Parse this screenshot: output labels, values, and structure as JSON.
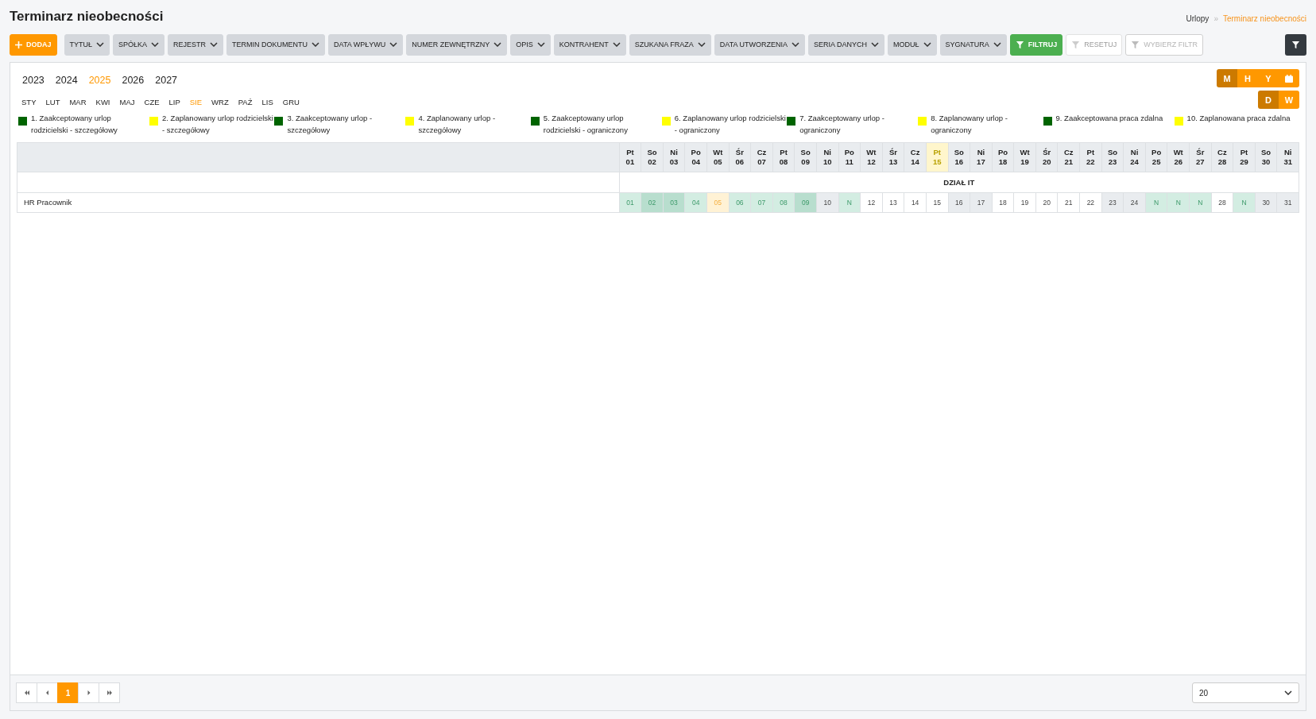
{
  "page": {
    "title": "Terminarz nieobecności"
  },
  "breadcrumb": {
    "items": [
      {
        "label": "Urlopy",
        "current": false
      },
      {
        "label": "Terminarz nieobecności",
        "current": true
      }
    ],
    "separator": "»"
  },
  "toolbar": [
    {
      "label": "DODAJ",
      "kind": "add",
      "disabled": false
    },
    {
      "label": "TYTUŁ",
      "kind": "dropdown",
      "disabled": false
    },
    {
      "label": "SPÓŁKA",
      "kind": "dropdown",
      "disabled": false
    },
    {
      "label": "REJESTR",
      "kind": "dropdown",
      "disabled": false
    },
    {
      "label": "TERMIN DOKUMENTU",
      "kind": "dropdown",
      "disabled": false
    },
    {
      "label": "DATA WPŁYWU",
      "kind": "dropdown",
      "disabled": false
    },
    {
      "label": "NUMER ZEWNĘTRZNY",
      "kind": "dropdown",
      "disabled": false
    },
    {
      "label": "OPIS",
      "kind": "dropdown",
      "disabled": false
    },
    {
      "label": "KONTRAHENT",
      "kind": "dropdown",
      "disabled": false
    },
    {
      "label": "SZUKANA FRAZA",
      "kind": "dropdown",
      "disabled": false
    },
    {
      "label": "DATA UTWORZENIA",
      "kind": "dropdown",
      "disabled": false
    },
    {
      "label": "SERIA DANYCH",
      "kind": "dropdown",
      "disabled": false
    },
    {
      "label": "MODUŁ",
      "kind": "dropdown",
      "disabled": false
    },
    {
      "label": "SYGNATURA",
      "kind": "dropdown",
      "disabled": false
    },
    {
      "label": "FILTRUJ",
      "kind": "filter",
      "disabled": false
    },
    {
      "label": "RESETUJ",
      "kind": "reset",
      "disabled": true
    },
    {
      "label": "WYBIERZ FILTR",
      "kind": "choose",
      "disabled": true
    }
  ],
  "years": [
    {
      "label": "2023",
      "selected": false
    },
    {
      "label": "2024",
      "selected": false
    },
    {
      "label": "2025",
      "selected": true
    },
    {
      "label": "2026",
      "selected": false
    },
    {
      "label": "2027",
      "selected": false
    }
  ],
  "months": [
    {
      "label": "STY",
      "selected": false
    },
    {
      "label": "LUT",
      "selected": false
    },
    {
      "label": "MAR",
      "selected": false
    },
    {
      "label": "KWI",
      "selected": false
    },
    {
      "label": "MAJ",
      "selected": false
    },
    {
      "label": "CZE",
      "selected": false
    },
    {
      "label": "LIP",
      "selected": false
    },
    {
      "label": "SIE",
      "selected": true
    },
    {
      "label": "WRZ",
      "selected": false
    },
    {
      "label": "PAŹ",
      "selected": false
    },
    {
      "label": "LIS",
      "selected": false
    },
    {
      "label": "GRU",
      "selected": false
    }
  ],
  "view_modes": [
    {
      "kind": "text",
      "label": "M",
      "selected": true
    },
    {
      "kind": "text",
      "label": "H",
      "selected": false
    },
    {
      "kind": "text",
      "label": "Y",
      "selected": false
    },
    {
      "kind": "calendar",
      "selected": false
    }
  ],
  "range_modes": [
    {
      "label": "D",
      "selected": true
    },
    {
      "label": "W",
      "selected": false
    }
  ],
  "legend": [
    {
      "label": "1. Zaakceptowany urlop rodzicielski - szczegółowy",
      "color": "#006400"
    },
    {
      "label": "2. Zaplanowany urlop rodzicielski - szczegółowy",
      "color": "#ffff00"
    },
    {
      "label": "3. Zaakceptowany urlop - szczegółowy",
      "color": "#006400"
    },
    {
      "label": "4. Zaplanowany urlop - szczegółowy",
      "color": "#ffff00"
    },
    {
      "label": "5. Zaakceptowany urlop rodzicielski - ograniczony",
      "color": "#006400"
    },
    {
      "label": "6. Zaplanowany urlop rodzicielski - ograniczony",
      "color": "#ffff00"
    },
    {
      "label": "7. Zaakceptowany urlop - ograniczony",
      "color": "#006400"
    },
    {
      "label": "8. Zaplanowany urlop - ograniczony",
      "color": "#ffff00"
    },
    {
      "label": "9. Zaakceptowana praca zdalna",
      "color": "#006400"
    },
    {
      "label": "10. Zaplanowana praca zdalna",
      "color": "#ffff00"
    }
  ],
  "table": {
    "days": [
      {
        "weekday": "Pt",
        "day": "01",
        "today": false
      },
      {
        "weekday": "So",
        "day": "02",
        "today": false
      },
      {
        "weekday": "Ni",
        "day": "03",
        "today": false
      },
      {
        "weekday": "Po",
        "day": "04",
        "today": false
      },
      {
        "weekday": "Wt",
        "day": "05",
        "today": false
      },
      {
        "weekday": "Śr",
        "day": "06",
        "today": false
      },
      {
        "weekday": "Cz",
        "day": "07",
        "today": false
      },
      {
        "weekday": "Pt",
        "day": "08",
        "today": false
      },
      {
        "weekday": "So",
        "day": "09",
        "today": false
      },
      {
        "weekday": "Ni",
        "day": "10",
        "today": false
      },
      {
        "weekday": "Po",
        "day": "11",
        "today": false
      },
      {
        "weekday": "Wt",
        "day": "12",
        "today": false
      },
      {
        "weekday": "Śr",
        "day": "13",
        "today": false
      },
      {
        "weekday": "Cz",
        "day": "14",
        "today": false
      },
      {
        "weekday": "Pt",
        "day": "15",
        "today": true
      },
      {
        "weekday": "So",
        "day": "16",
        "today": false
      },
      {
        "weekday": "Ni",
        "day": "17",
        "today": false
      },
      {
        "weekday": "Po",
        "day": "18",
        "today": false
      },
      {
        "weekday": "Wt",
        "day": "19",
        "today": false
      },
      {
        "weekday": "Śr",
        "day": "20",
        "today": false
      },
      {
        "weekday": "Cz",
        "day": "21",
        "today": false
      },
      {
        "weekday": "Pt",
        "day": "22",
        "today": false
      },
      {
        "weekday": "So",
        "day": "23",
        "today": false
      },
      {
        "weekday": "Ni",
        "day": "24",
        "today": false
      },
      {
        "weekday": "Po",
        "day": "25",
        "today": false
      },
      {
        "weekday": "Wt",
        "day": "26",
        "today": false
      },
      {
        "weekday": "Śr",
        "day": "27",
        "today": false
      },
      {
        "weekday": "Cz",
        "day": "28",
        "today": false
      },
      {
        "weekday": "Pt",
        "day": "29",
        "today": false
      },
      {
        "weekday": "So",
        "day": "30",
        "today": false
      },
      {
        "weekday": "Ni",
        "day": "31",
        "today": false
      }
    ],
    "group": "DZIAŁ IT",
    "rows": [
      {
        "name": "HR Pracownik",
        "cells": [
          {
            "text": "01",
            "kind": "accepted"
          },
          {
            "text": "02",
            "kind": "accepted-weekend"
          },
          {
            "text": "03",
            "kind": "accepted-weekend"
          },
          {
            "text": "04",
            "kind": "accepted"
          },
          {
            "text": "05",
            "kind": "planned"
          },
          {
            "text": "06",
            "kind": "accepted"
          },
          {
            "text": "07",
            "kind": "accepted"
          },
          {
            "text": "08",
            "kind": "accepted"
          },
          {
            "text": "09",
            "kind": "accepted-weekend"
          },
          {
            "text": "10",
            "kind": "weekend"
          },
          {
            "text": "N",
            "kind": "accepted"
          },
          {
            "text": "12",
            "kind": "workday"
          },
          {
            "text": "13",
            "kind": "workday"
          },
          {
            "text": "14",
            "kind": "workday"
          },
          {
            "text": "15",
            "kind": "workday"
          },
          {
            "text": "16",
            "kind": "weekend"
          },
          {
            "text": "17",
            "kind": "weekend"
          },
          {
            "text": "18",
            "kind": "workday"
          },
          {
            "text": "19",
            "kind": "workday"
          },
          {
            "text": "20",
            "kind": "workday"
          },
          {
            "text": "21",
            "kind": "workday"
          },
          {
            "text": "22",
            "kind": "workday"
          },
          {
            "text": "23",
            "kind": "weekend"
          },
          {
            "text": "24",
            "kind": "weekend"
          },
          {
            "text": "N",
            "kind": "accepted"
          },
          {
            "text": "N",
            "kind": "accepted"
          },
          {
            "text": "N",
            "kind": "accepted"
          },
          {
            "text": "28",
            "kind": "workday"
          },
          {
            "text": "N",
            "kind": "accepted"
          },
          {
            "text": "30",
            "kind": "weekend"
          },
          {
            "text": "31",
            "kind": "weekend"
          }
        ]
      }
    ]
  },
  "pagination": {
    "buttons": [
      {
        "kind": "first"
      },
      {
        "kind": "prev"
      },
      {
        "kind": "page",
        "label": "1",
        "selected": true
      },
      {
        "kind": "next"
      },
      {
        "kind": "last"
      }
    ],
    "page_size": "20"
  }
}
